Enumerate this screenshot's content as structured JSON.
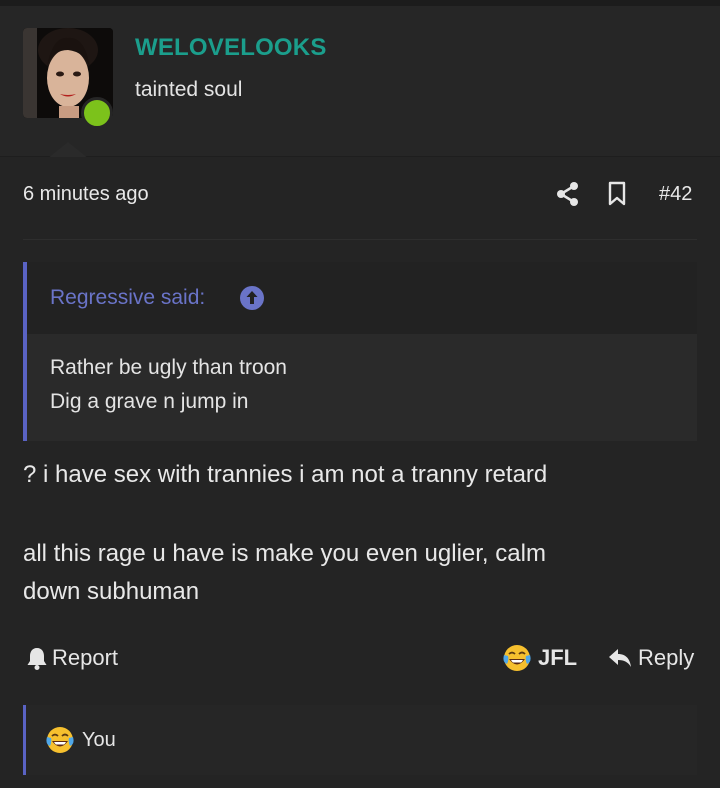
{
  "author": {
    "username": "WELOVELOOKS",
    "user_title": "tainted soul",
    "online": true
  },
  "post": {
    "timestamp": "6 minutes ago",
    "number": "#42",
    "quote": {
      "author_label": "Regressive said:",
      "lines": [
        "Rather be ugly than troon",
        "Dig a grave n jump in"
      ]
    },
    "message_lines": [
      "? i have sex with trannies i am not a tranny retard",
      "all this rage u have is make you even uglier, calm",
      "down subhuman"
    ]
  },
  "actions": {
    "report_label": "Report",
    "reaction_label": "JFL",
    "reply_label": "Reply"
  },
  "reactions": {
    "users": "You"
  },
  "colors": {
    "username": "#1b9e8c",
    "online": "#7cc21b",
    "quote_accent": "#5a63c4"
  },
  "icons": [
    "share-icon",
    "bookmark-icon",
    "arrow-up-circle-icon",
    "bell-icon",
    "crying-laughing-emoji-icon",
    "reply-arrow-icon"
  ]
}
